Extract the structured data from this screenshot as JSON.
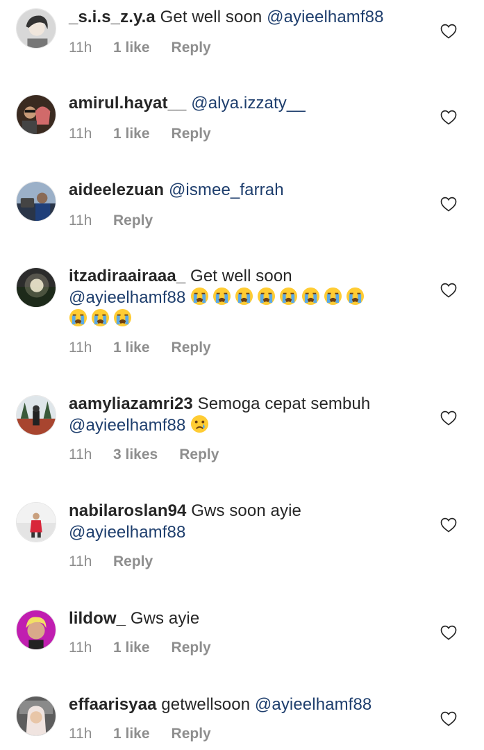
{
  "comments": [
    {
      "username": "_s.i.s_z.y.a",
      "text": " Get well soon ",
      "mention": "@ayieelhamf88",
      "time": "11h",
      "likes": "1 like",
      "reply": "Reply"
    },
    {
      "username": "amirul.hayat__",
      "text": " ",
      "mention": "@alya.izzaty__",
      "time": "11h",
      "likes": "1 like",
      "reply": "Reply"
    },
    {
      "username": "aideelezuan",
      "text": " ",
      "mention": "@ismee_farrah",
      "time": "11h",
      "likes": "",
      "reply": "Reply"
    },
    {
      "username": "itzadiraairaaa_",
      "text": " Get well soon ",
      "mention": "@ayieelhamf88",
      "emojis": [
        "loudly-crying-face",
        "loudly-crying-face",
        "loudly-crying-face",
        "loudly-crying-face",
        "loudly-crying-face",
        "loudly-crying-face",
        "loudly-crying-face",
        "loudly-crying-face",
        "loudly-crying-face",
        "loudly-crying-face",
        "loudly-crying-face"
      ],
      "time": "11h",
      "likes": "1 like",
      "reply": "Reply"
    },
    {
      "username": "aamyliazamri23",
      "text": " Semoga cepat sembuh ",
      "mention": "@ayieelhamf88",
      "emojis": [
        "crying-face"
      ],
      "time": "11h",
      "likes": "3 likes",
      "reply": "Reply"
    },
    {
      "username": "nabilaroslan94",
      "text": " Gws soon ayie ",
      "mention": "@ayieelhamf88",
      "time": "11h",
      "likes": "",
      "reply": "Reply"
    },
    {
      "username": "lildow_",
      "text": " Gws ayie",
      "mention": "",
      "time": "11h",
      "likes": "1 like",
      "reply": "Reply"
    },
    {
      "username": "effaarisyaa",
      "text": " getwellsoon ",
      "mention": "@ayieelhamf88",
      "time": "11h",
      "likes": "1 like",
      "reply": "Reply"
    }
  ],
  "colors": {
    "text": "#262626",
    "mention": "#1e3e6d",
    "meta": "#8e8e8e"
  },
  "icons": [
    "heart-outline-icon",
    "avatar"
  ]
}
